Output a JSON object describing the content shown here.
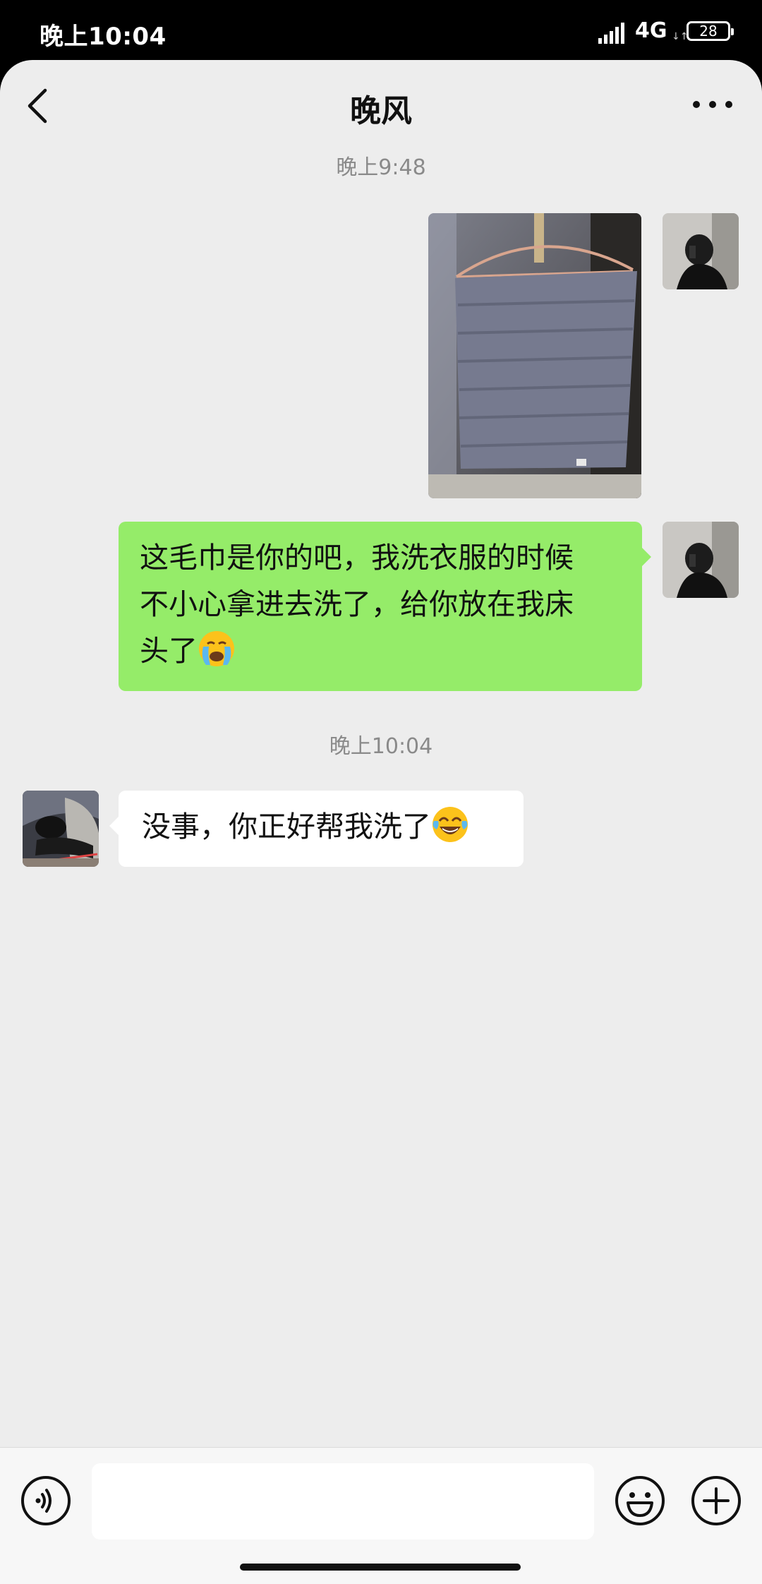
{
  "status_bar": {
    "time": "晚上10:04",
    "network": "4G",
    "network_sub": "↓↑",
    "battery": "28"
  },
  "header": {
    "title": "晚风",
    "back_icon": "chevron-left-icon",
    "more_icon": "more-dots-icon"
  },
  "messages": [
    {
      "type": "timestamp",
      "text": "晚上9:48"
    },
    {
      "type": "image",
      "side": "right",
      "content": "photo of a grey towel hanging on a hanger"
    },
    {
      "type": "text",
      "side": "right",
      "lines": [
        "这毛巾是你的吧，我洗衣服的时候",
        "不小心拿进去洗了，给你放在我床",
        "头了"
      ],
      "emoji": "loudly-crying-emoji"
    },
    {
      "type": "timestamp",
      "text": "晚上10:04"
    },
    {
      "type": "text",
      "side": "left",
      "lines": [
        "没事，你正好帮我洗了"
      ],
      "emoji": "tears-of-joy-emoji"
    }
  ],
  "input_bar": {
    "voice_icon": "voice-icon",
    "value": "",
    "emoji_icon": "emoji-icon",
    "add_icon": "plus-circle-icon"
  },
  "colors": {
    "background": "#ededed",
    "sent_bubble": "#95ec69",
    "received_bubble": "#ffffff",
    "timestamp": "#8a8a8a"
  }
}
